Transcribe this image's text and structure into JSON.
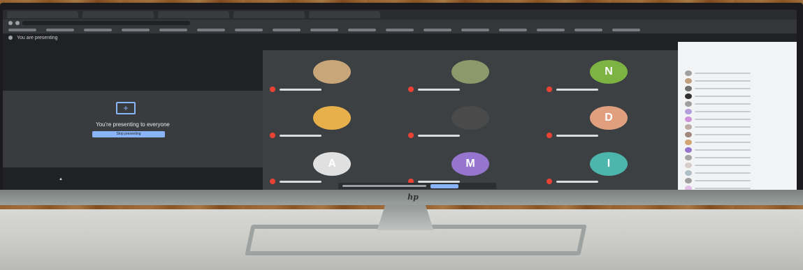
{
  "scene": {
    "brand_logo_text": "hp"
  },
  "screen": {
    "tabs": [
      "",
      "",
      "",
      "",
      ""
    ],
    "presenting_bar": {
      "title": "You are presenting"
    },
    "present_panel": {
      "message": "You're presenting to everyone",
      "stop_button_label": "Stop presenting"
    },
    "participants": [
      {
        "initial": "",
        "avatar_color": "#c9a57a",
        "muted": true
      },
      {
        "initial": "",
        "avatar_color": "#8b9a6a",
        "muted": true
      },
      {
        "initial": "N",
        "avatar_color": "#7cb342",
        "muted": true
      },
      {
        "initial": "",
        "avatar_color": "#e8b04a",
        "muted": true
      },
      {
        "initial": "",
        "avatar_color": "#4a4a4a",
        "muted": true
      },
      {
        "initial": "D",
        "avatar_color": "#e0a080",
        "muted": true
      },
      {
        "initial": "A",
        "avatar_color": "#e0e0e0",
        "muted": true
      },
      {
        "initial": "M",
        "avatar_color": "#9575cd",
        "muted": true
      },
      {
        "initial": "I",
        "avatar_color": "#4db6ac",
        "muted": true
      }
    ],
    "people_panel": {
      "avatar_colors": [
        "#a0a0a0",
        "#c0a080",
        "#707070",
        "#303030",
        "#9e9e9e",
        "#b39ddb",
        "#ce93d8",
        "#bcaaa4",
        "#a1887f",
        "#d4a373",
        "#9575cd",
        "#a5a5a5",
        "#d7ccc8",
        "#b0bec5",
        "#9e9e9e",
        "#e1bee7"
      ]
    },
    "taskbar_icon_colors": [
      "#ffffff",
      "#4285f4",
      "#34a853",
      "#ea4335",
      "#9c27b0",
      "#e91e63",
      "#fbbc05",
      "#ffffff"
    ]
  }
}
